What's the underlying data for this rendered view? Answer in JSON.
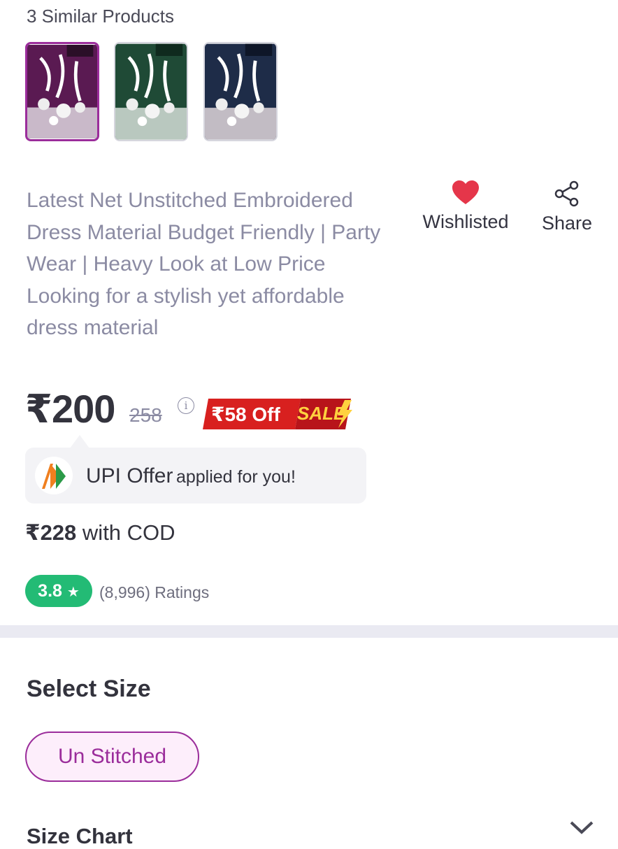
{
  "similar": {
    "heading": "3 Similar Products",
    "items": [
      {
        "name": "purple-dress-material",
        "color": "#5a1a52"
      },
      {
        "name": "green-dress-material",
        "color": "#1f4a36"
      },
      {
        "name": "navy-dress-material",
        "color": "#1e2c48"
      }
    ]
  },
  "product": {
    "title": "Latest Net Unstitched Embroidered Dress Material Budget Friendly | Party Wear | Heavy Look at Low Price  Looking for a stylish yet affordable dress material",
    "wishlist_label": "Wishlisted",
    "share_label": "Share",
    "price": "₹200",
    "mrp": "258",
    "off_label": "₹58 Off",
    "sale_label": "SALE",
    "upi_offer_bold": "UPI Offer",
    "upi_offer_rest": "applied for you!",
    "cod_price": "₹228",
    "cod_label": "with COD",
    "rating_value": "3.8",
    "rating_count": "(8,996) Ratings"
  },
  "size": {
    "heading": "Select Size",
    "options": [
      "Un Stitched"
    ],
    "size_chart_label": "Size Chart"
  },
  "colors": {
    "accent": "#9b2d9b",
    "rating_green": "#23bb75",
    "heart_red": "#e5364a",
    "sale_red": "#d8201f"
  }
}
